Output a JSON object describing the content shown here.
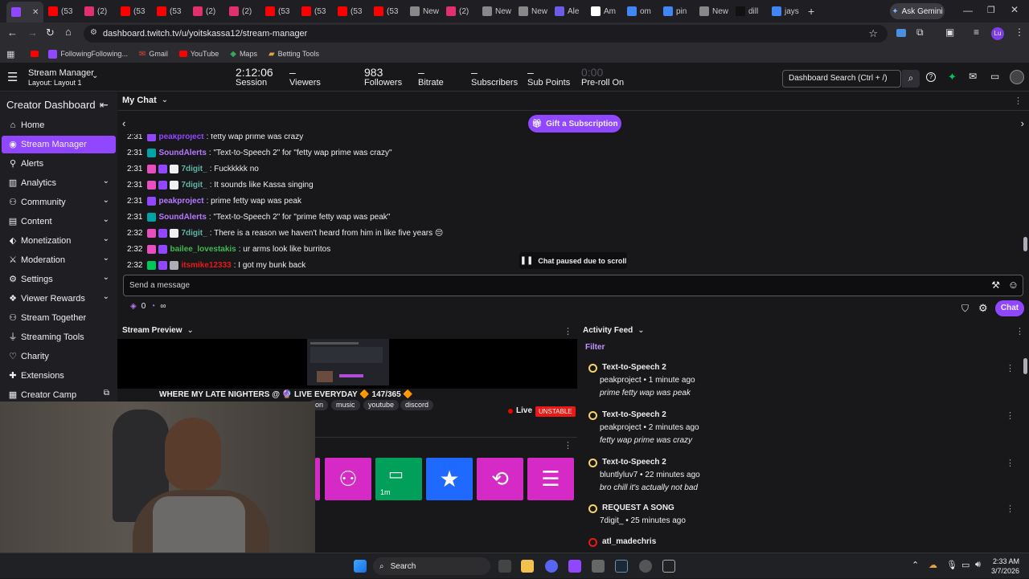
{
  "browser": {
    "tabs": [
      "",
      "(53",
      "(2)",
      "(53",
      "(53",
      "(2)",
      "(2)",
      "(53",
      "(53",
      "(53",
      "(53",
      "New",
      "(2)",
      "New",
      "New",
      "Ale",
      "Am",
      "om",
      "pin",
      "New",
      "dill",
      "jays"
    ],
    "ask_gemini": "Ask Gemini",
    "url": "dashboard.twitch.tv/u/yoitskassa12/stream-manager",
    "bookmarks": [
      "FollowingFollowing...",
      "Gmail",
      "YouTube",
      "Maps",
      "Betting Tools"
    ]
  },
  "header": {
    "app_title": "Stream Manager",
    "layout": "Layout: Layout 1",
    "stats": [
      {
        "value": "2:12:06",
        "label": "Session"
      },
      {
        "value": "–",
        "label": "Viewers"
      },
      {
        "value": "983",
        "label": "Followers"
      },
      {
        "value": "–",
        "label": "Bitrate"
      },
      {
        "value": "–",
        "label": "Subscribers"
      },
      {
        "value": "–",
        "label": "Sub Points"
      },
      {
        "value": "0:00",
        "label": "Pre-roll On"
      }
    ],
    "search_placeholder": "Dashboard Search (Ctrl + /)"
  },
  "sidebar": {
    "title": "Creator Dashboard",
    "items": [
      {
        "label": "Home",
        "icon": "home-icon",
        "chev": false
      },
      {
        "label": "Stream Manager",
        "icon": "broadcast-icon",
        "chev": false,
        "active": true
      },
      {
        "label": "Alerts",
        "icon": "bell-icon",
        "chev": false
      },
      {
        "label": "Analytics",
        "icon": "chart-icon",
        "chev": true
      },
      {
        "label": "Community",
        "icon": "community-icon",
        "chev": true
      },
      {
        "label": "Content",
        "icon": "content-icon",
        "chev": true
      },
      {
        "label": "Monetization",
        "icon": "money-icon",
        "chev": true
      },
      {
        "label": "Moderation",
        "icon": "sword-icon",
        "chev": true
      },
      {
        "label": "Settings",
        "icon": "gear-icon",
        "chev": true
      },
      {
        "label": "Viewer Rewards",
        "icon": "gift-icon",
        "chev": true
      },
      {
        "label": "Stream Together",
        "icon": "users-icon",
        "chev": false
      },
      {
        "label": "Streaming Tools",
        "icon": "mic-icon",
        "chev": false
      },
      {
        "label": "Charity",
        "icon": "heart-icon",
        "chev": false
      },
      {
        "label": "Extensions",
        "icon": "puzzle-icon",
        "chev": false
      },
      {
        "label": "Creator Camp",
        "icon": "camp-icon",
        "chev": false,
        "external": true
      }
    ]
  },
  "chat": {
    "title": "My Chat",
    "gift_label": "Gift a Subscription",
    "lines": [
      {
        "time": "2:31",
        "user": "peakproject",
        "ucolor": "#9147ff",
        "text": ": fetty wap prime was crazy",
        "badges": [
          "#9147ff"
        ]
      },
      {
        "time": "2:31",
        "user": "SoundAlerts",
        "ucolor": "#b57aff",
        "text": ": \"Text-to-Speech 2\" for \"fetty wap prime was crazy\"",
        "badges": [
          "#00a3a3"
        ]
      },
      {
        "time": "2:31",
        "user": "7digit_",
        "ucolor": "#5fb4a8",
        "text": ": Fuckkkkk no",
        "badges": [
          "#e64fbd",
          "#9147ff",
          "#efeff1"
        ]
      },
      {
        "time": "2:31",
        "user": "7digit_",
        "ucolor": "#5fb4a8",
        "text": ": It sounds like Kassa singing",
        "badges": [
          "#e64fbd",
          "#9147ff",
          "#efeff1"
        ]
      },
      {
        "time": "2:31",
        "user": "peakproject",
        "ucolor": "#b57aff",
        "text": ": prime fetty wap was peak",
        "badges": [
          "#9147ff"
        ]
      },
      {
        "time": "2:31",
        "user": "SoundAlerts",
        "ucolor": "#b57aff",
        "text": ": \"Text-to-Speech 2\" for \"prime fetty wap was peak\"",
        "badges": [
          "#00a3a3"
        ]
      },
      {
        "time": "2:32",
        "user": "7digit_",
        "ucolor": "#5fb4a8",
        "text": ": There is a reason we haven't heard from him in like five years 😔",
        "badges": [
          "#e64fbd",
          "#9147ff",
          "#efeff1"
        ]
      },
      {
        "time": "2:32",
        "user": "bailee_lovestakis",
        "ucolor": "#3fb950",
        "text": ": ur arms look like burritos",
        "badges": [
          "#e64fbd",
          "#9147ff"
        ]
      },
      {
        "time": "2:32",
        "user": "itsmike12333",
        "ucolor": "#e91916",
        "text": ": I got my bunk back",
        "badges": [
          "#00c75a",
          "#9147ff",
          "#adadb8"
        ]
      }
    ],
    "paused_label": "Chat paused due to scroll",
    "input_placeholder": "Send a message",
    "points": "0",
    "infinity": "∞",
    "chat_button": "Chat"
  },
  "preview": {
    "title": "Stream Preview",
    "stream_title": "WHERE MY LATE NIGHTERS @ 🔮 LIVE EVERYDAY 🔶 147/365 🔶",
    "tags": [
      "ion",
      "music",
      "youtube",
      "discord"
    ],
    "live": "Live",
    "status": "UNSTABLE",
    "quick_action_timer": "1m"
  },
  "activity": {
    "title": "Activity Feed",
    "filter": "Filter",
    "items": [
      {
        "title": "Text-to-Speech 2",
        "user": "peakproject",
        "time": "1 minute ago",
        "msg": "prime fetty wap was peak"
      },
      {
        "title": "Text-to-Speech 2",
        "user": "peakproject",
        "time": "2 minutes ago",
        "msg": "fetty wap prime was crazy"
      },
      {
        "title": "Text-to-Speech 2",
        "user": "bluntlyluv7",
        "time": "22 minutes ago",
        "msg": "bro chill it's actually not bad"
      },
      {
        "title": "REQUEST A SONG",
        "user": "7digit_",
        "time": "25 minutes ago",
        "msg": ""
      },
      {
        "title": "atl_madechris",
        "user": "",
        "time": "",
        "msg": ""
      }
    ]
  },
  "taskbar": {
    "search": "Search",
    "time": "2:33 AM",
    "date": "3/7/2026"
  },
  "colors": {
    "accent": "#9147ff",
    "bg": "#18181b",
    "panel": "#1f1f23"
  }
}
